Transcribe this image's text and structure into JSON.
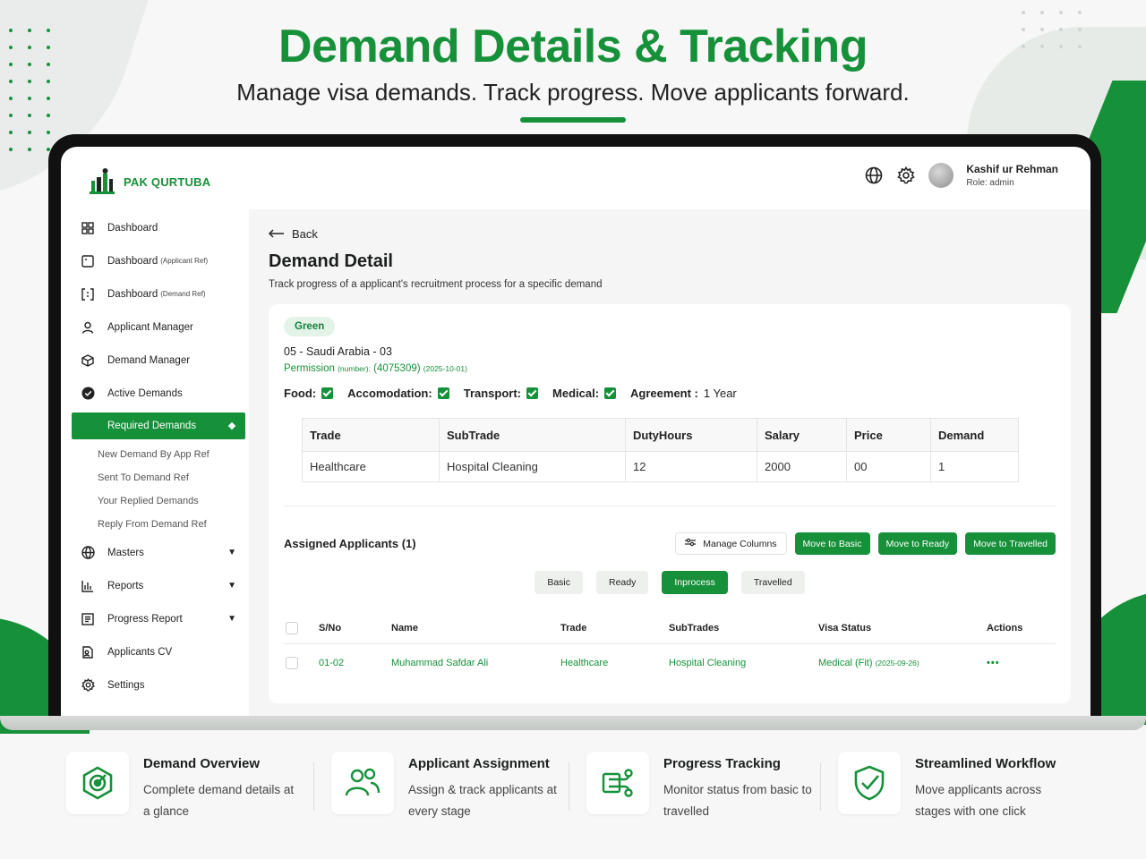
{
  "hero": {
    "title": "Demand Details & Tracking",
    "subtitle": "Manage visa demands. Track progress. Move applicants forward."
  },
  "brand": {
    "name": "PAK QURTUBA",
    "accent": "#16913a"
  },
  "header": {
    "icons": [
      "globe-icon",
      "gear-icon"
    ],
    "user_name": "Kashif ur Rehman",
    "user_role": "Role: admin"
  },
  "sidebar": {
    "items": [
      {
        "label": "Dashboard",
        "suffix": "",
        "icon": "grid-icon"
      },
      {
        "label": "Dashboard",
        "suffix": "(Applicant Ref)",
        "icon": "square-icon"
      },
      {
        "label": "Dashboard",
        "suffix": "(Demand Ref)",
        "icon": "bracket-icon"
      },
      {
        "label": "Applicant Manager",
        "suffix": "",
        "icon": "user-icon"
      },
      {
        "label": "Demand Manager",
        "suffix": "",
        "icon": "cube-icon"
      },
      {
        "label": "Active Demands",
        "suffix": "",
        "icon": "check-circle-icon"
      }
    ],
    "active_item": "Required Demands",
    "sub_items": [
      "New Demand By App Ref",
      "Sent To Demand Ref",
      "Your Replied Demands",
      "Reply From Demand Ref"
    ],
    "more_items": [
      {
        "label": "Masters",
        "icon": "globe-grid-icon",
        "caret": "▼"
      },
      {
        "label": "Reports",
        "icon": "bar-chart-icon",
        "caret": "▼"
      },
      {
        "label": "Progress Report",
        "icon": "report-icon",
        "caret": "▼"
      },
      {
        "label": "Applicants CV",
        "icon": "document-icon",
        "caret": ""
      },
      {
        "label": "Settings",
        "icon": "gear-icon",
        "caret": ""
      }
    ]
  },
  "main": {
    "back_label": "Back",
    "title": "Demand Detail",
    "subtitle": "Track progress of a applicant's recruitment process for a specific demand",
    "status_pill": "Green",
    "demand_code": "05 - Saudi Arabia - 03",
    "permission_label": "Permission",
    "permission_small": "(number):",
    "permission_number": "(4075309)",
    "permission_date": "(2025-10-01)",
    "facilities": {
      "food": "Food:",
      "accomodation": "Accomodation:",
      "transport": "Transport:",
      "medical": "Medical:",
      "agreement_label": "Agreement :",
      "agreement_value": "1 Year"
    },
    "trade_table": {
      "headers": [
        "Trade",
        "SubTrade",
        "DutyHours",
        "Salary",
        "Price",
        "Demand"
      ],
      "rows": [
        [
          "Healthcare",
          "Hospital Cleaning",
          "12",
          "2000",
          "00",
          "1"
        ]
      ]
    },
    "assigned_title": "Assigned Applicants (1)",
    "buttons": {
      "manage_columns": "Manage Columns",
      "move_basic": "Move to Basic",
      "move_ready": "Move to Ready",
      "move_travelled": "Move to Travelled"
    },
    "tabs": [
      "Basic",
      "Ready",
      "Inprocess",
      "Travelled"
    ],
    "active_tab": "Inprocess",
    "applicants_table": {
      "headers": [
        "S/No",
        "Name",
        "Trade",
        "SubTrades",
        "Visa Status",
        "Actions"
      ],
      "rows": [
        {
          "sno": "01-02",
          "name": "Muhammad Safdar Ali",
          "trade": "Healthcare",
          "subtrade": "Hospital Cleaning",
          "visa_status": "Medical (Fit)",
          "visa_date": "(2025-09-26)",
          "actions": "•••"
        }
      ]
    }
  },
  "features": [
    {
      "title": "Demand Overview",
      "desc": "Complete demand details at a glance",
      "icon": "target-icon"
    },
    {
      "title": "Applicant Assignment",
      "desc": "Assign & track applicants at every stage",
      "icon": "users-icon"
    },
    {
      "title": "Progress Tracking",
      "desc": "Monitor status from basic to travelled",
      "icon": "flow-icon"
    },
    {
      "title": "Streamlined Workflow",
      "desc": "Move applicants across stages with one click",
      "icon": "shield-check-icon"
    }
  ]
}
